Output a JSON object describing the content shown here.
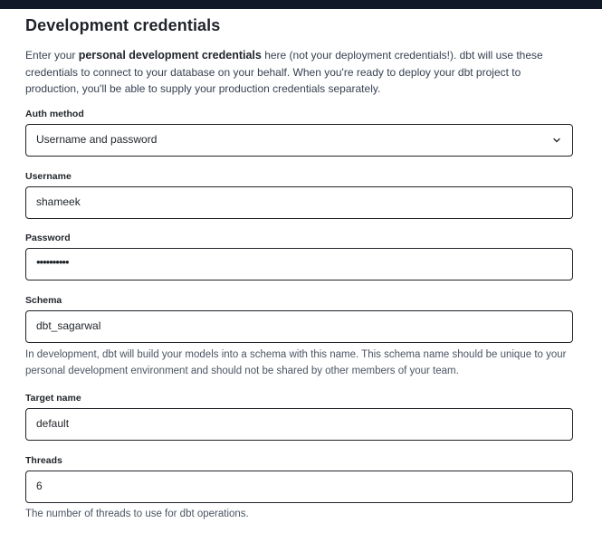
{
  "section": {
    "title": "Development credentials",
    "intro_prefix": "Enter your ",
    "intro_bold": "personal development credentials",
    "intro_suffix": " here (not your deployment credentials!). dbt will use these credentials to connect to your database on your behalf. When you're ready to deploy your dbt project to production, you'll be able to supply your production credentials separately."
  },
  "fields": {
    "auth_method": {
      "label": "Auth method",
      "value": "Username and password",
      "icon": "chevron-down-icon"
    },
    "username": {
      "label": "Username",
      "value": "shameek"
    },
    "password": {
      "label": "Password",
      "value": "••••••••••"
    },
    "schema": {
      "label": "Schema",
      "value": "dbt_sagarwal",
      "help": "In development, dbt will build your models into a schema with this name. This schema name should be unique to your personal development environment and should not be shared by other members of your team."
    },
    "target_name": {
      "label": "Target name",
      "value": "default"
    },
    "threads": {
      "label": "Threads",
      "value": "6",
      "help": "The number of threads to use for dbt operations."
    }
  }
}
